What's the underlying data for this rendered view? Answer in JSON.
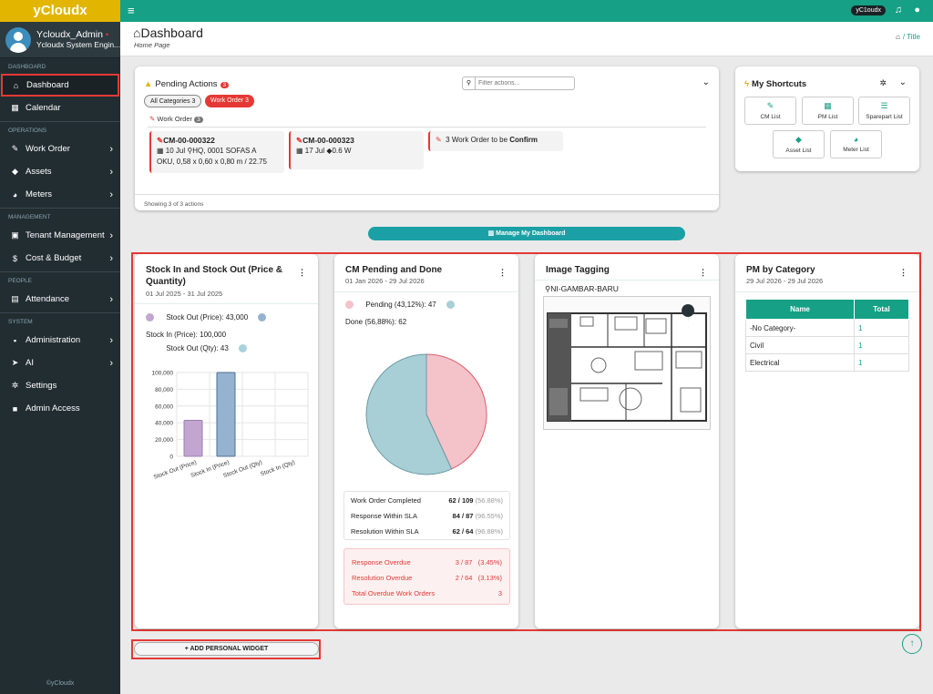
{
  "brand": "yCloudx",
  "user": {
    "name": "Ycloudx_Admin",
    "role": "Ycloudx System Engin...",
    "status_dot": "•"
  },
  "sidebar": {
    "sections": {
      "dashboard": "DASHBOARD",
      "operations": "OPERATIONS",
      "management": "MANAGEMENT",
      "people": "PEOPLE",
      "system": "SYSTEM"
    },
    "items": {
      "dashboard": "Dashboard",
      "calendar": "Calendar",
      "work_order": "Work Order",
      "assets": "Assets",
      "meters": "Meters",
      "tenant": "Tenant Management",
      "cost": "Cost & Budget",
      "attendance": "Attendance",
      "administration": "Administration",
      "ai": "AI",
      "settings": "Settings",
      "admin_access": "Admin Access"
    },
    "footer": "©yCloudx"
  },
  "topbar": {
    "user_pill": "yC1oudx"
  },
  "header": {
    "title": "Dashboard",
    "subtitle": "Home Page",
    "breadcrumb": "Title"
  },
  "pending": {
    "title": "Pending Actions",
    "count": "3",
    "filter_placeholder": "Filter actions...",
    "chip_all": "All Categories 3",
    "chip_wo": "Work Order 3",
    "group_label": "Work Order",
    "group_count": "3",
    "cards": [
      {
        "id": "CM-00-000322",
        "date": "10 Jul",
        "loc": "HQ, 0001 SOFAS A",
        "loc2": "OKU, 0,58 x 0,60 x 0,80 m / 22.75"
      },
      {
        "id": "CM-00-000323",
        "date": "17 Jul",
        "tag": "0.6 W"
      }
    ],
    "confirm_prefix": "3 Work Order to be ",
    "confirm_bold": "Confirm",
    "showing": "Showing 3 of 3 actions"
  },
  "shortcuts": {
    "title": "My Shortcuts",
    "items": [
      "CM List",
      "PM List",
      "Sparepart List",
      "Asset List",
      "Meter List"
    ]
  },
  "manage_label": "Manage My Dashboard",
  "widgets": {
    "stock": {
      "title_1": "Stock In and Stock Out (Price &",
      "title_2": "Quantity)",
      "date": "01 Jul 2025 - 31 Jul 2025",
      "legend": [
        "Stock Out (Price): 43,000",
        "Stock In (Price): 100,000",
        "Stock Out (Qty): 43"
      ]
    },
    "cm": {
      "title": "CM Pending and Done",
      "date": "01 Jan 2026 - 29 Jul 2026",
      "legend_pending": "Pending (43,12%): 47",
      "legend_done": "Done (56,88%): 62",
      "stats": [
        {
          "label": "Work Order Completed",
          "val": "62 / 109",
          "pct": "(56.88%)"
        },
        {
          "label": "Response Within SLA",
          "val": "84 / 87",
          "pct": "(96.55%)"
        },
        {
          "label": "Resolution Within SLA",
          "val": "62 / 64",
          "pct": "(96.88%)"
        }
      ],
      "overdue": [
        {
          "label": "Response Overdue",
          "val": "3 / 87",
          "pct": "(3.45%)"
        },
        {
          "label": "Resolution Overdue",
          "val": "2 / 64",
          "pct": "(3.13%)"
        },
        {
          "label": "Total Overdue Work Orders",
          "val": "3"
        }
      ]
    },
    "image": {
      "title": "Image Tagging",
      "location": "NI-GAMBAR-BARU"
    },
    "pm": {
      "title": "PM by Category",
      "date": "29 Jul 2026 - 29 Jul 2026",
      "col_name": "Name",
      "col_total": "Total",
      "rows": [
        {
          "name": "-No Category-",
          "total": "1"
        },
        {
          "name": "Civil",
          "total": "1"
        },
        {
          "name": "Electrical",
          "total": "1"
        }
      ]
    }
  },
  "add_widget": "ADD PERSONAL WIDGET",
  "colors": {
    "teal": "#16a085",
    "sidebar": "#222d32",
    "brand": "#e2b500",
    "pending": "#f4c2c9",
    "done": "#a8cfd6",
    "stock_out_price": "#c3a6d0",
    "stock_in_price": "#95b3d0",
    "stock_out_qty": "#a9d2dc"
  },
  "chart_data": [
    {
      "type": "bar",
      "categories": [
        "Stock Out (Price)",
        "Stock In (Price)",
        "Stock Out (Qty)",
        "Stock In (Qty)"
      ],
      "values": [
        43000,
        100000,
        43,
        0
      ],
      "ylim": [
        0,
        100000
      ],
      "yticks": [
        "0",
        "20,000",
        "40,000",
        "60,000",
        "80,000",
        "100,000"
      ],
      "grid": true
    },
    {
      "type": "pie",
      "labels": [
        "Pending",
        "Done"
      ],
      "values": [
        47,
        62
      ],
      "percent": [
        43.12,
        56.88
      ]
    }
  ]
}
